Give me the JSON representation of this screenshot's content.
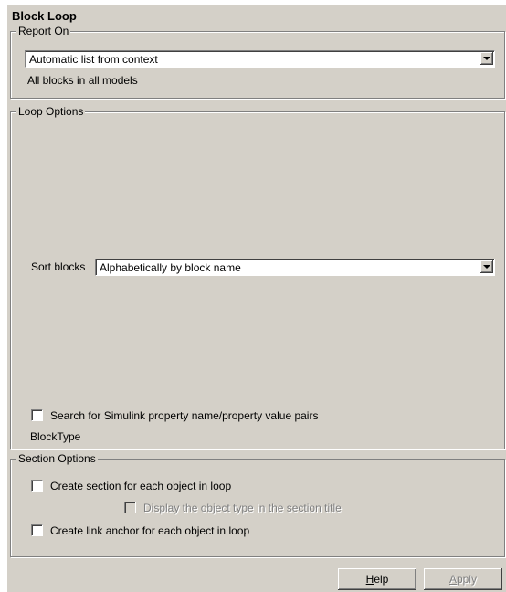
{
  "title": "Block Loop",
  "report_on": {
    "legend": "Report On",
    "dropdown_value": "Automatic list from context",
    "description": "All blocks in all models"
  },
  "loop_options": {
    "legend": "Loop Options",
    "sort_label": "Sort blocks",
    "sort_value": "Alphabetically by block name",
    "search_checkbox_label": "Search for Simulink property name/property value pairs",
    "search_checked": false,
    "property_text": "BlockType"
  },
  "section_options": {
    "legend": "Section Options",
    "create_section_label": "Create section for each object in loop",
    "create_section_checked": false,
    "display_type_label": "Display the object type in the section title",
    "display_type_checked": false,
    "display_type_enabled": false,
    "link_anchor_label": "Create link anchor for each object in loop",
    "link_anchor_checked": false
  },
  "buttons": {
    "help_mnemonic": "H",
    "help_rest": "elp",
    "apply_mnemonic": "A",
    "apply_rest": "pply",
    "apply_enabled": false
  }
}
